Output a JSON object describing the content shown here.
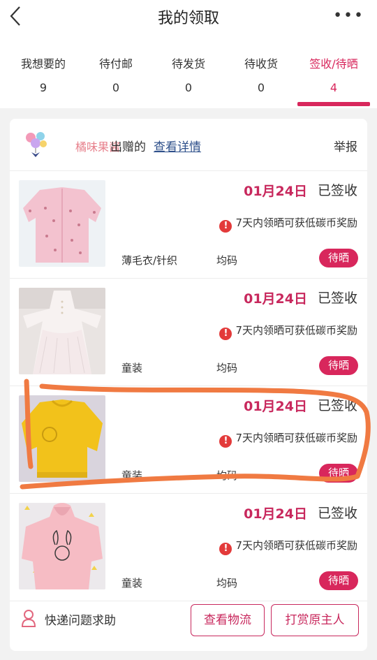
{
  "header": {
    "title": "我的领取",
    "more_label": "•••"
  },
  "tabs": [
    {
      "label": "我想要的",
      "count": "9"
    },
    {
      "label": "待付邮",
      "count": "0"
    },
    {
      "label": "待发货",
      "count": "0"
    },
    {
      "label": "待收货",
      "count": "0"
    },
    {
      "label": "签收/待晒",
      "count": "4"
    }
  ],
  "giver": {
    "name": "橘味果酱",
    "suffix": "出赠的",
    "detail_link": "查看详情",
    "report": "举报"
  },
  "items": [
    {
      "date": "01月24日",
      "status": "已签收",
      "notice": "7天内领晒可获低碳币奖励",
      "category": "薄毛衣/针织",
      "size": "均码",
      "badge": "待晒"
    },
    {
      "date": "01月24日",
      "status": "已签收",
      "notice": "7天内领晒可获低碳币奖励",
      "category": "童装",
      "size": "均码",
      "badge": "待晒"
    },
    {
      "date": "01月24日",
      "status": "已签收",
      "notice": "7天内领晒可获低碳币奖励",
      "category": "童装",
      "size": "均码",
      "badge": "待晒"
    },
    {
      "date": "01月24日",
      "status": "已签收",
      "notice": "7天内领晒可获低碳币奖励",
      "category": "童装",
      "size": "均码",
      "badge": "待晒"
    }
  ],
  "footer": {
    "help_text": "快递问题求助",
    "logistics_button": "查看物流",
    "tip_button": "打赏原主人"
  },
  "colors": {
    "accent": "#d8275c",
    "annotation": "#f07a42"
  }
}
